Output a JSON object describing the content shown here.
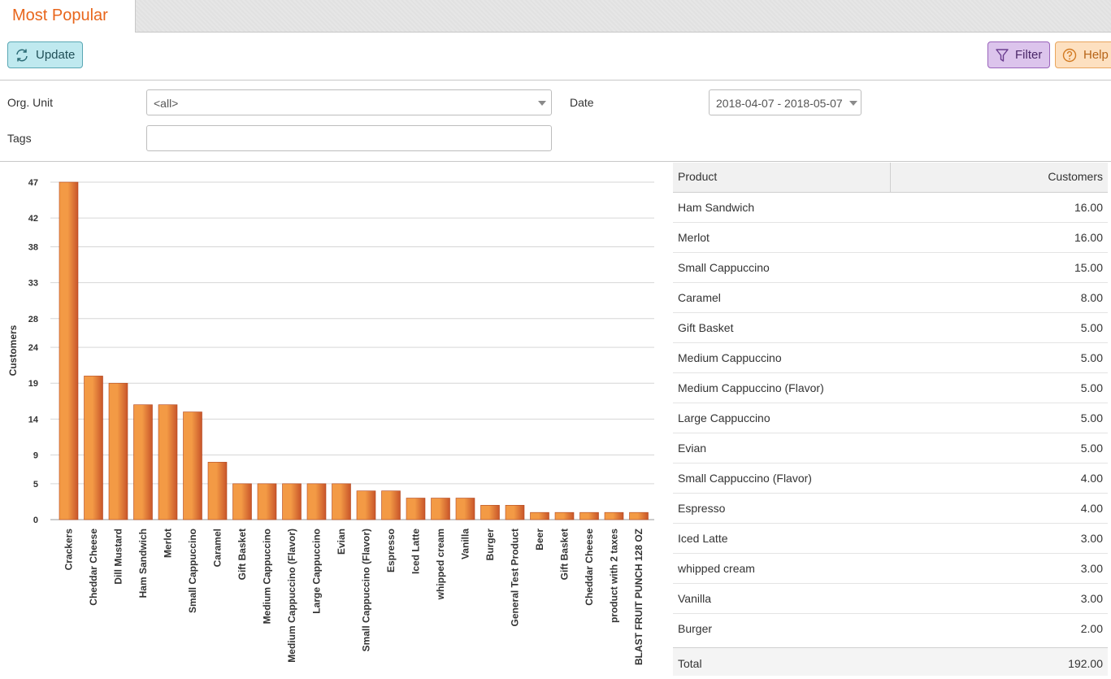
{
  "tab": {
    "title": "Most Popular"
  },
  "toolbar": {
    "update_label": "Update",
    "filter_label": "Filter",
    "help_label": "Help"
  },
  "filters": {
    "org_unit_label": "Org. Unit",
    "org_unit_value": "<all>",
    "date_label": "Date",
    "date_value": "2018-04-07 - 2018-05-07",
    "tags_label": "Tags",
    "tags_value": ""
  },
  "colors": {
    "accent": "#e8661c",
    "bar_light": "#f39a45",
    "bar_dark": "#c8552a"
  },
  "chart_data": {
    "type": "bar",
    "ylabel": "Customers",
    "yticks": [
      0,
      5,
      9,
      14,
      19,
      24,
      28,
      33,
      38,
      42,
      47
    ],
    "ylim": [
      0,
      47
    ],
    "grid": true,
    "categories": [
      "Crackers",
      "Cheddar Cheese",
      "Dill Mustard",
      "Ham Sandwich",
      "Merlot",
      "Small Cappuccino",
      "Caramel",
      "Gift Basket",
      "Medium Cappuccino",
      "Medium Cappuccino (Flavor)",
      "Large Cappuccino",
      "Evian",
      "Small Cappuccino (Flavor)",
      "Espresso",
      "Iced Latte",
      "whipped cream",
      "Vanilla",
      "Burger",
      "General Test Product",
      "Beer",
      "Gift Basket",
      "Cheddar Cheese",
      "product with 2 taxes",
      "BLAST FRUIT PUNCH 128 OZ"
    ],
    "values": [
      47,
      20,
      19,
      16,
      16,
      15,
      8,
      5,
      5,
      5,
      5,
      5,
      4,
      4,
      3,
      3,
      3,
      2,
      2,
      1,
      1,
      1,
      1,
      1
    ]
  },
  "table": {
    "headers": [
      "Product",
      "Customers"
    ],
    "rows": [
      [
        "Ham Sandwich",
        "16.00"
      ],
      [
        "Merlot",
        "16.00"
      ],
      [
        "Small Cappuccino",
        "15.00"
      ],
      [
        "Caramel",
        "8.00"
      ],
      [
        "Gift Basket",
        "5.00"
      ],
      [
        "Medium Cappuccino",
        "5.00"
      ],
      [
        "Medium Cappuccino (Flavor)",
        "5.00"
      ],
      [
        "Large Cappuccino",
        "5.00"
      ],
      [
        "Evian",
        "5.00"
      ],
      [
        "Small Cappuccino (Flavor)",
        "4.00"
      ],
      [
        "Espresso",
        "4.00"
      ],
      [
        "Iced Latte",
        "3.00"
      ],
      [
        "whipped cream",
        "3.00"
      ],
      [
        "Vanilla",
        "3.00"
      ],
      [
        "Burger",
        "2.00"
      ]
    ],
    "total_label": "Total",
    "total_value": "192.00"
  }
}
